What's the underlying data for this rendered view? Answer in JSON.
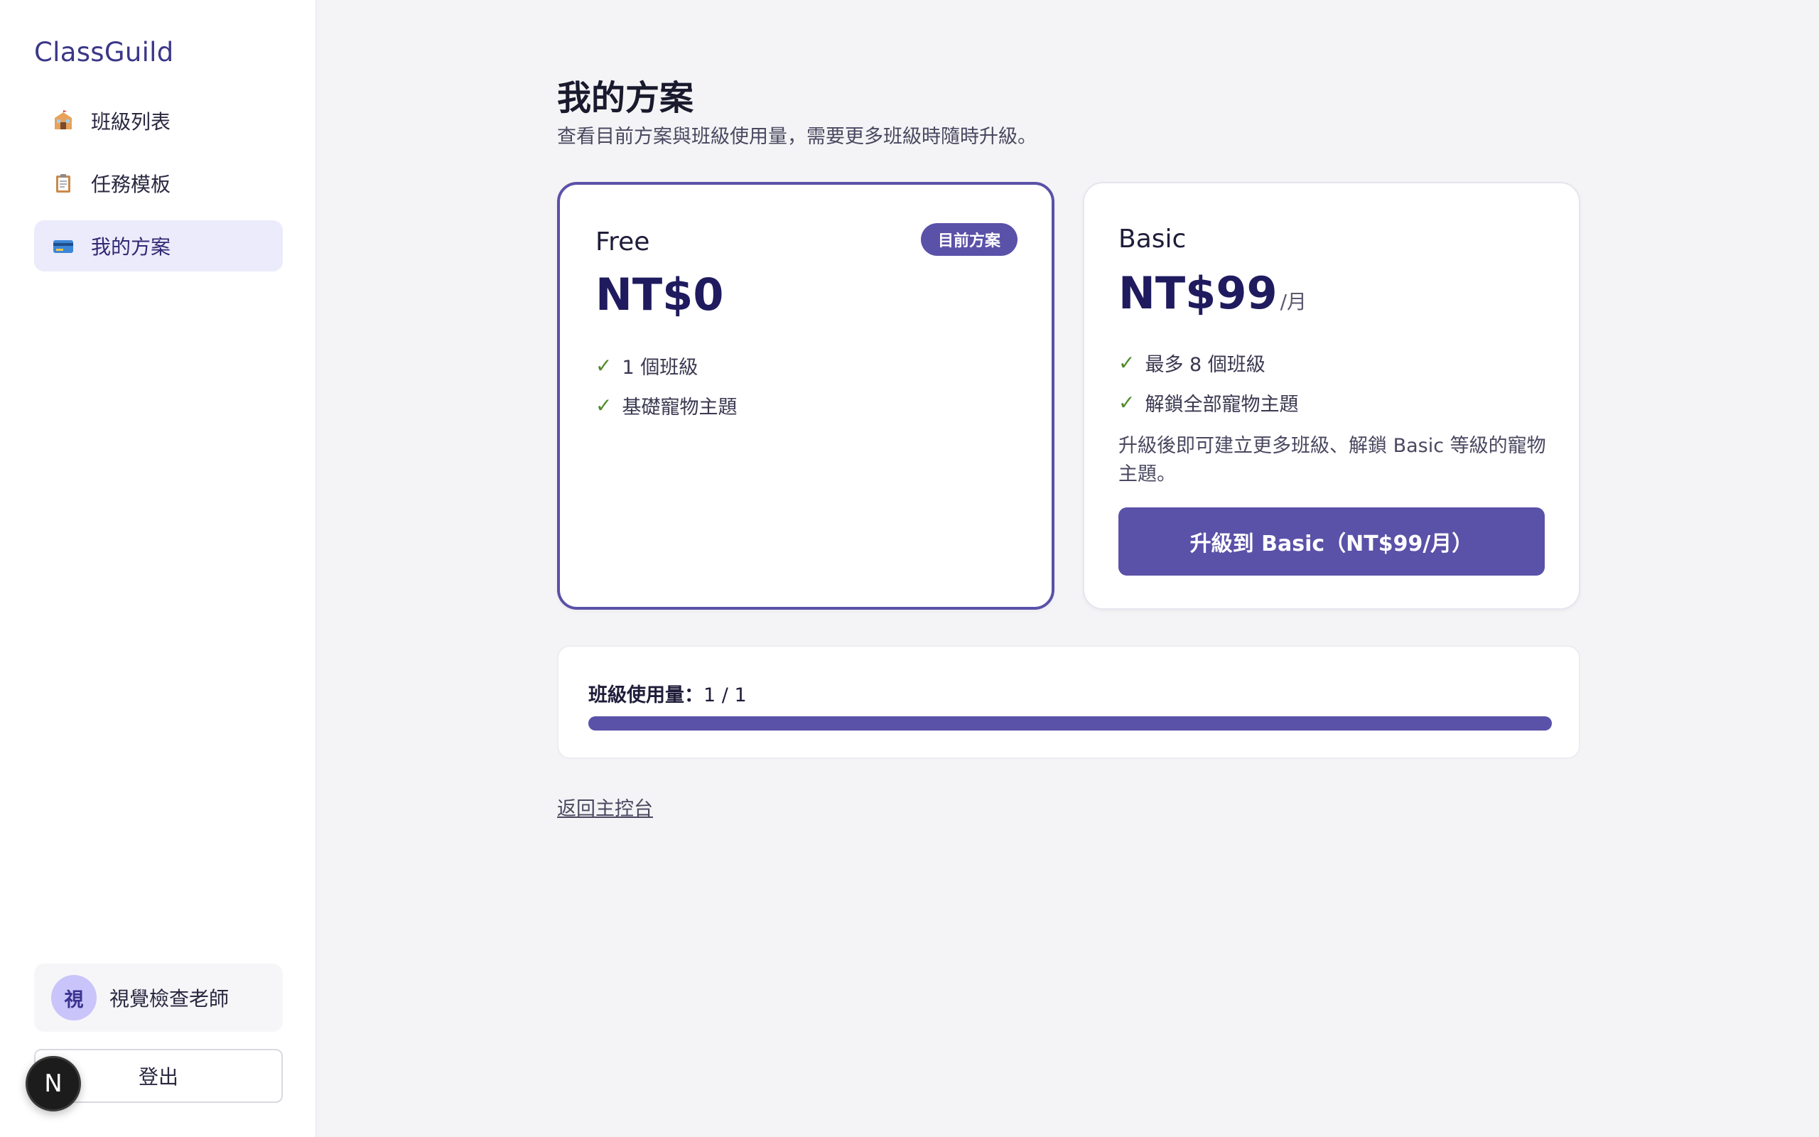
{
  "app": {
    "brand": "ClassGuild"
  },
  "sidebar": {
    "items": [
      {
        "icon": "school-icon",
        "label": "班級列表",
        "active": false
      },
      {
        "icon": "clipboard-icon",
        "label": "任務模板",
        "active": false
      },
      {
        "icon": "credit-card-icon",
        "label": "我的方案",
        "active": true
      }
    ],
    "user": {
      "avatar_text": "視",
      "name": "視覺檢查老師"
    },
    "logout_label": "登出",
    "dev_badge": "N"
  },
  "main": {
    "title": "我的方案",
    "subtitle": "查看目前方案與班級使用量，需要更多班級時隨時升級。",
    "plans": {
      "free": {
        "name": "Free",
        "badge": "目前方案",
        "price": "NT$0",
        "features": [
          "1 個班級",
          "基礎寵物主題"
        ]
      },
      "basic": {
        "name": "Basic",
        "price": "NT$99",
        "unit": "/月",
        "features": [
          "最多 8 個班級",
          "解鎖全部寵物主題"
        ],
        "description": "升級後即可建立更多班級、解鎖 Basic 等級的寵物主題。",
        "upgrade_label": "升級到 Basic（NT$99/月）"
      }
    },
    "usage": {
      "label": "班級使用量：",
      "value": "1 / 1",
      "used": 1,
      "total": 1
    },
    "back_link": "返回主控台"
  },
  "colors": {
    "accent": "#5a51a8",
    "brand": "#3b3788",
    "check": "#4f8a2c"
  }
}
